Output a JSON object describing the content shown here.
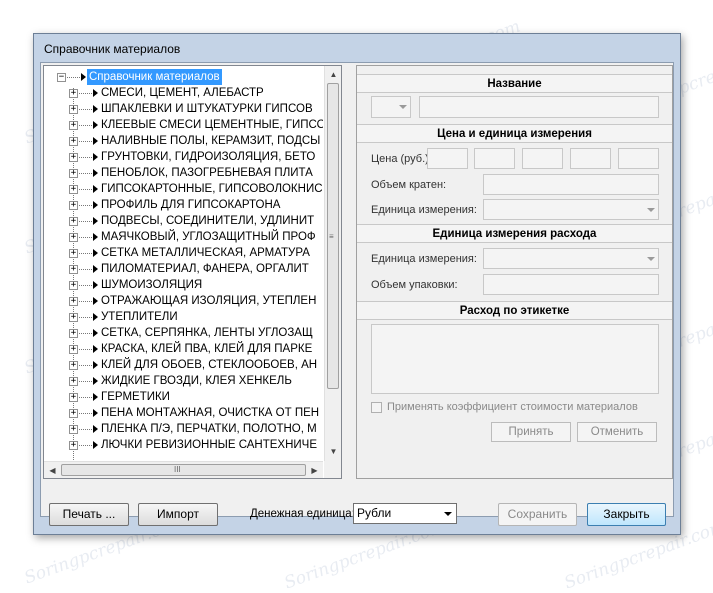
{
  "window": {
    "title": "Справочник материалов"
  },
  "tree": {
    "root": "Справочник материалов",
    "items": [
      "СМЕСИ, ЦЕМЕНТ, АЛЕБАСТР",
      "ШПАКЛЕВКИ И ШТУКАТУРКИ ГИПСОВ",
      "КЛЕЕВЫЕ СМЕСИ ЦЕМЕНТНЫЕ, ГИПСО",
      "НАЛИВНЫЕ ПОЛЫ, КЕРАМЗИТ, ПОДСЫ",
      "ГРУНТОВКИ, ГИДРОИЗОЛЯЦИЯ, БЕТО",
      "ПЕНОБЛОК, ПАЗОГРЕБНЕВАЯ ПЛИТА",
      "ГИПСОКАРТОННЫЕ, ГИПСОВОЛОКНИС",
      "ПРОФИЛЬ ДЛЯ ГИПСОКАРТОНА",
      "ПОДВЕСЫ, СОЕДИНИТЕЛИ, УДЛИНИТ",
      "МАЯЧКОВЫЙ, УГЛОЗАЩИТНЫЙ ПРОФ",
      "СЕТКА МЕТАЛЛИЧЕСКАЯ, АРМАТУРА",
      "ПИЛОМАТЕРИАЛ, ФАНЕРА, ОРГАЛИТ",
      "ШУМОИЗОЛЯЦИЯ",
      "ОТРАЖАЮЩАЯ ИЗОЛЯЦИЯ, УТЕПЛЕН",
      "УТЕПЛИТЕЛИ",
      "СЕТКА, СЕРПЯНКА, ЛЕНТЫ УГЛОЗАЩ",
      "КРАСКА, КЛЕЙ ПВА, КЛЕЙ ДЛЯ ПАРКЕ",
      "КЛЕЙ ДЛЯ ОБОЕВ, СТЕКЛООБОЕВ, АН",
      "ЖИДКИЕ ГВОЗДИ, КЛЕЯ ХЕНКЕЛЬ",
      "ГЕРМЕТИКИ",
      "ПЕНА МОНТАЖНАЯ, ОЧИСТКА ОТ ПЕН",
      "ПЛЕНКА П/Э, ПЕРЧАТКИ, ПОЛОТНО, М",
      "ЛЮЧКИ РЕВИЗИОННЫЕ САНТЕХНИЧЕ"
    ],
    "scroll_grip": "≡",
    "hscroll_grip": "III"
  },
  "details": {
    "name_header": "Название",
    "price_header": "Цена и единица измерения",
    "price_label": "Цена (руб.)",
    "volume_label": "Объем кратен:",
    "unit_label": "Единица измерения:",
    "consumption_header": "Единица измерения расхода",
    "cons_unit_label": "Единица измерения:",
    "pack_label": "Объем упаковки:",
    "label_header": "Расход по этикетке",
    "coef_checkbox": "Применять коэффициент стоимости материалов",
    "accept_button": "Принять",
    "cancel_button": "Отменить"
  },
  "footer": {
    "print_button": "Печать ...",
    "import_button": "Импорт",
    "currency_label": "Денежная единица:",
    "currency_value": "Рубли",
    "save_button": "Сохранить",
    "close_button": "Закрыть"
  },
  "watermark": "Soringpcrepair.com"
}
